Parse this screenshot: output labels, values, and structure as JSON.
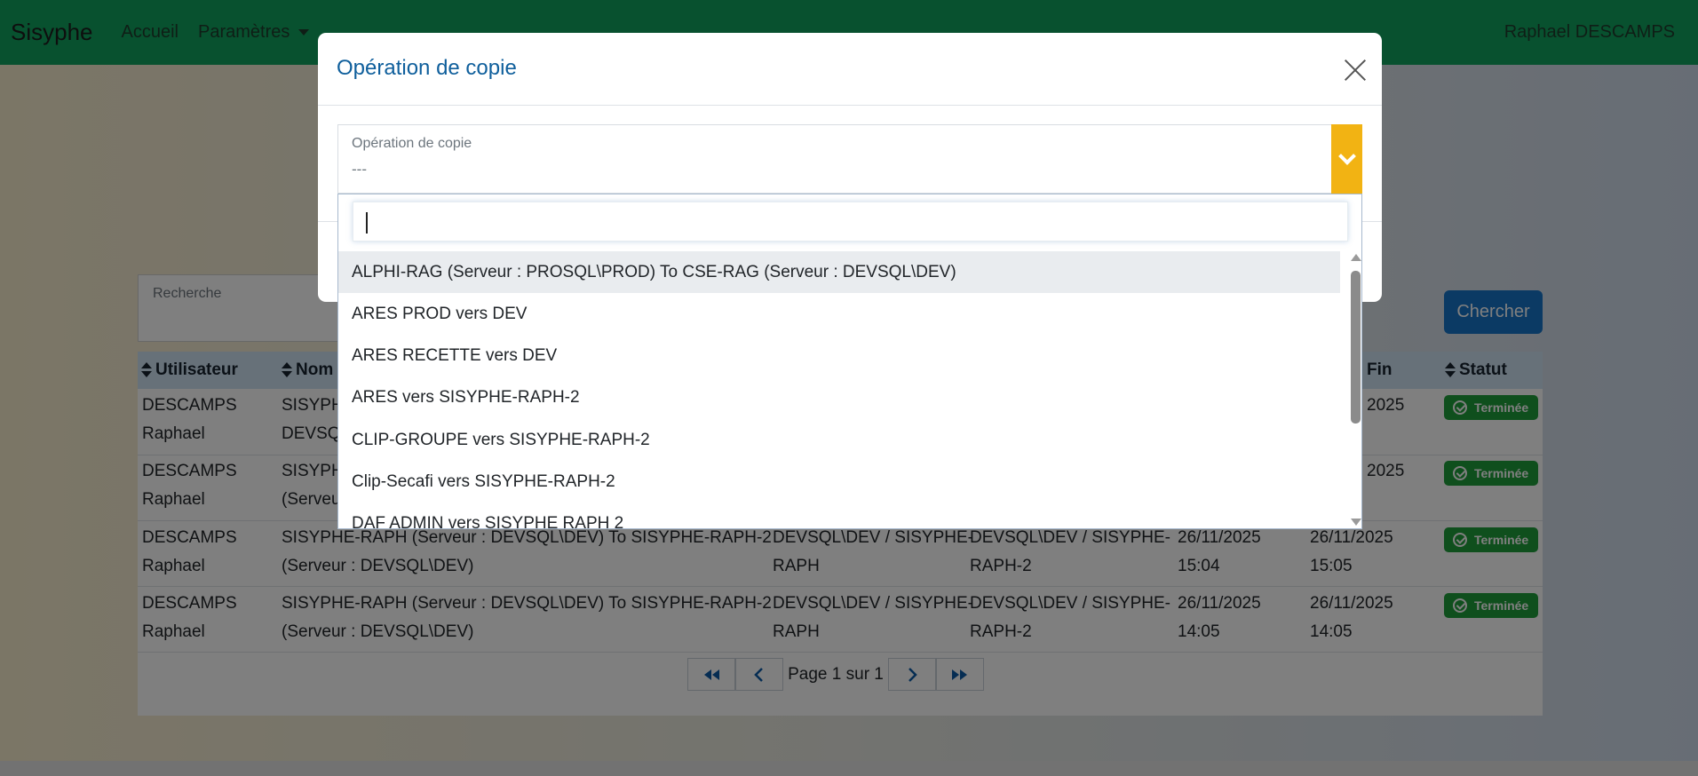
{
  "navbar": {
    "brand": "Sisyphe",
    "home": "Accueil",
    "settings": "Paramètres",
    "user": "Raphael DESCAMPS"
  },
  "search": {
    "label": "Recherche",
    "button": "Chercher"
  },
  "table": {
    "headers": {
      "user": "Utilisateur",
      "name": "Nom",
      "end": "Fin",
      "status": "Statut"
    },
    "rows": [
      {
        "user1": "DESCAMPS",
        "user2": "Raphael",
        "name1": "SISYPH",
        "name2": "DEVSQL",
        "source1": "",
        "source2": "",
        "target1": "",
        "target2": "",
        "start1": "",
        "start2": "",
        "end1": "2025",
        "end2": "",
        "status": "Terminée"
      },
      {
        "user1": "DESCAMPS",
        "user2": "Raphael",
        "name1": "SISYPH",
        "name2": "(Serveu",
        "source1": "",
        "source2": "",
        "target1": "",
        "target2": "",
        "start1": "",
        "start2": "",
        "end1": "2025",
        "end2": "",
        "status": "Terminée"
      },
      {
        "user1": "DESCAMPS",
        "user2": "Raphael",
        "name1": "SISYPHE-RAPH (Serveur : DEVSQL\\DEV) To SISYPHE-RAPH-2",
        "name2": "(Serveur : DEVSQL\\DEV)",
        "source1": "DEVSQL\\DEV / SISYPHE-",
        "source2": "RAPH",
        "target1": "DEVSQL\\DEV / SISYPHE-",
        "target2": "RAPH-2",
        "start1": "26/11/2025",
        "start2": "15:04",
        "end1": "26/11/2025",
        "end2": "15:05",
        "status": "Terminée"
      },
      {
        "user1": "DESCAMPS",
        "user2": "Raphael",
        "name1": "SISYPHE-RAPH (Serveur : DEVSQL\\DEV) To SISYPHE-RAPH-2",
        "name2": "(Serveur : DEVSQL\\DEV)",
        "source1": "DEVSQL\\DEV / SISYPHE-",
        "source2": "RAPH",
        "target1": "DEVSQL\\DEV / SISYPHE-",
        "target2": "RAPH-2",
        "start1": "26/11/2025",
        "start2": "14:05",
        "end1": "26/11/2025",
        "end2": "14:05",
        "status": "Terminée"
      }
    ]
  },
  "pager": {
    "text": "Page 1 sur 1"
  },
  "modal": {
    "title": "Opération de copie",
    "select_label": "Opération de copie",
    "select_value": "---",
    "options": [
      "ALPHI-RAG (Serveur : PROSQL\\PROD) To CSE-RAG (Serveur : DEVSQL\\DEV)",
      "ARES PROD vers DEV",
      "ARES RECETTE vers DEV",
      "ARES vers SISYPHE-RAPH-2",
      "CLIP-GROUPE vers SISYPHE-RAPH-2",
      "Clip-Secafi vers SISYPHE-RAPH-2",
      "DAF ADMIN vers SISYPHE RAPH 2"
    ]
  },
  "colors": {
    "navbar": "#10a35f",
    "accent": "#f2b313",
    "primary": "#1674c9",
    "success": "#1f9e3a"
  }
}
